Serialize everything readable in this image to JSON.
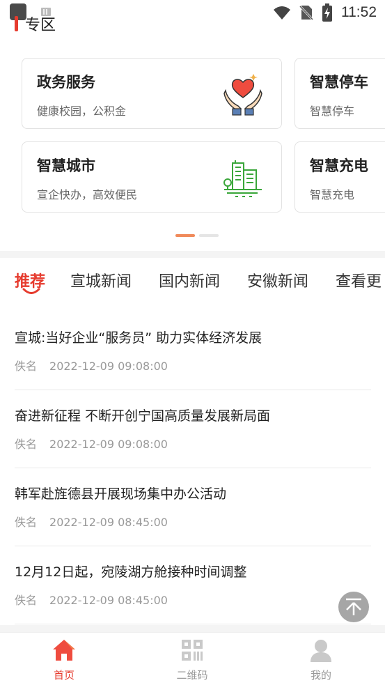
{
  "status_bar": {
    "time": "11:52",
    "icons": [
      "app-icon",
      "sim-icon",
      "wifi-icon",
      "no-sim-icon",
      "battery-charging-icon"
    ]
  },
  "section": {
    "title": "专区"
  },
  "cards": [
    {
      "title": "政务服务",
      "subtitle": "健康校园，公积金",
      "icon": "hands-heart-icon"
    },
    {
      "title": "智慧停车",
      "subtitle": "智慧停车",
      "icon": ""
    },
    {
      "title": "智慧城市",
      "subtitle": "宣企快办，高效便民",
      "icon": "city-buildings-icon"
    },
    {
      "title": "智慧充电",
      "subtitle": "智慧充电",
      "icon": ""
    }
  ],
  "pager": {
    "count": 2,
    "active": 0
  },
  "tabs": [
    {
      "label": "推荐",
      "active": true
    },
    {
      "label": "宣城新闻",
      "active": false
    },
    {
      "label": "国内新闻",
      "active": false
    },
    {
      "label": "安徽新闻",
      "active": false
    },
    {
      "label": "查看更",
      "active": false
    }
  ],
  "news": [
    {
      "title": "宣城:当好企业“服务员” 助力实体经济发展",
      "author": "佚名",
      "date": "2022-12-09 09:08:00"
    },
    {
      "title": "奋进新征程 不断开创宁国高质量发展新局面",
      "author": "佚名",
      "date": "2022-12-09 09:08:00"
    },
    {
      "title": "韩军赴旌德县开展现场集中办公活动",
      "author": "佚名",
      "date": "2022-12-09 08:45:00"
    },
    {
      "title": "12月12日起，宛陵湖方舱接种时间调整",
      "author": "佚名",
      "date": "2022-12-09 08:45:00"
    }
  ],
  "bottom_nav": [
    {
      "label": "首页",
      "icon": "home-icon",
      "active": true
    },
    {
      "label": "二维码",
      "icon": "qr-code-icon",
      "active": false
    },
    {
      "label": "我的",
      "icon": "user-icon",
      "active": false
    }
  ],
  "colors": {
    "accent": "#e63b2e",
    "text_secondary": "#999999",
    "pager_active": "#f08a5a"
  }
}
